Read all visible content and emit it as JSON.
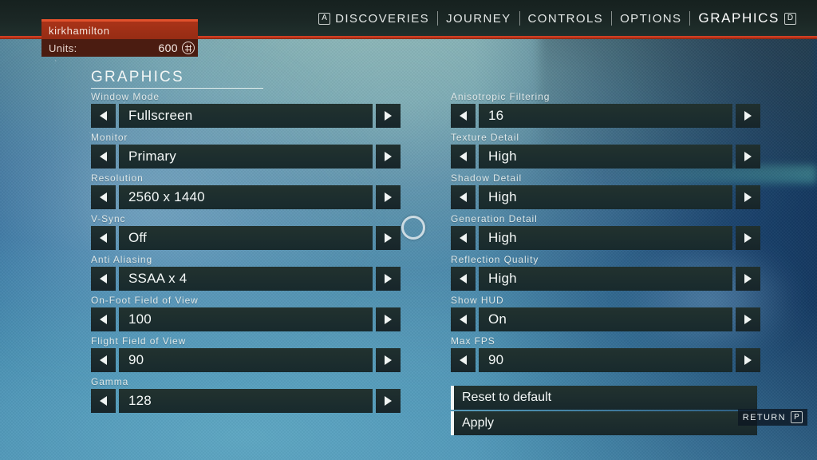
{
  "header": {
    "nav_items": [
      {
        "label": "DISCOVERIES",
        "key": "A",
        "key_side": "left",
        "active": false
      },
      {
        "label": "JOURNEY",
        "key": "",
        "key_side": "",
        "active": false
      },
      {
        "label": "CONTROLS",
        "key": "",
        "key_side": "",
        "active": false
      },
      {
        "label": "OPTIONS",
        "key": "",
        "key_side": "",
        "active": false
      },
      {
        "label": "GRAPHICS",
        "key": "D",
        "key_side": "right",
        "active": true
      }
    ],
    "accent_color": "#b93318"
  },
  "player": {
    "name": "kirkhamilton",
    "units_label": "Units:",
    "units_value": "600",
    "units_icon": "units-glyph-icon",
    "panel_color": "#a93318"
  },
  "page_title": "GRAPHICS",
  "settings_left": [
    {
      "label": "Window Mode",
      "value": "Fullscreen"
    },
    {
      "label": "Monitor",
      "value": "Primary"
    },
    {
      "label": "Resolution",
      "value": "2560 x 1440"
    },
    {
      "label": "V-Sync",
      "value": "Off"
    },
    {
      "label": "Anti Aliasing",
      "value": "SSAA x 4"
    },
    {
      "label": "On-Foot Field of View",
      "value": "100"
    },
    {
      "label": "Flight Field of View",
      "value": "90"
    },
    {
      "label": "Gamma",
      "value": "128"
    }
  ],
  "settings_right": [
    {
      "label": "Anisotropic Filtering",
      "value": "16"
    },
    {
      "label": "Texture Detail",
      "value": "High"
    },
    {
      "label": "Shadow Detail",
      "value": "High"
    },
    {
      "label": "Generation Detail",
      "value": "High"
    },
    {
      "label": "Reflection Quality",
      "value": "High"
    },
    {
      "label": "Show HUD",
      "value": "On"
    },
    {
      "label": "Max FPS",
      "value": "90"
    }
  ],
  "actions": [
    {
      "label": "Reset to default"
    },
    {
      "label": "Apply"
    }
  ],
  "return_hint": {
    "label": "RETURN",
    "key": "P"
  }
}
